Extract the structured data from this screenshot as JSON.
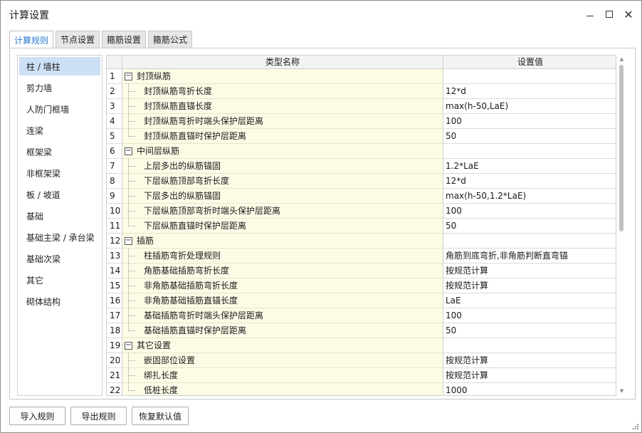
{
  "window": {
    "title": "计算设置",
    "minimize_icon": "minimize-icon",
    "maximize_icon": "maximize-icon",
    "close_icon": "close-icon",
    "close_glyph": "✕"
  },
  "tabs": [
    {
      "label": "计算规则",
      "active": true
    },
    {
      "label": "节点设置",
      "active": false
    },
    {
      "label": "箍筋设置",
      "active": false
    },
    {
      "label": "箍筋公式",
      "active": false
    }
  ],
  "sidebar": {
    "items": [
      {
        "label": "柱 / 墙柱",
        "selected": true
      },
      {
        "label": "剪力墙"
      },
      {
        "label": "人防门框墙"
      },
      {
        "label": "连梁"
      },
      {
        "label": "框架梁"
      },
      {
        "label": "非框架梁"
      },
      {
        "label": "板 / 坡道"
      },
      {
        "label": "基础"
      },
      {
        "label": "基础主梁 / 承台梁"
      },
      {
        "label": "基础次梁"
      },
      {
        "label": "其它"
      },
      {
        "label": "砌体结构"
      }
    ]
  },
  "grid": {
    "columns": {
      "name": "类型名称",
      "value": "设置值"
    },
    "rows": [
      {
        "num": "1",
        "name": "封顶纵筋",
        "value": "",
        "group": true,
        "toggle": "−"
      },
      {
        "num": "2",
        "name": "封顶纵筋弯折长度",
        "value": "12*d"
      },
      {
        "num": "3",
        "name": "封顶纵筋直锚长度",
        "value": "max(h-50,LaE)"
      },
      {
        "num": "4",
        "name": "封顶纵筋弯折时端头保护层距离",
        "value": "100"
      },
      {
        "num": "5",
        "name": "封顶纵筋直锚时保护层距离",
        "value": "50"
      },
      {
        "num": "6",
        "name": "中间层纵筋",
        "value": "",
        "group": true,
        "toggle": "−"
      },
      {
        "num": "7",
        "name": "上层多出的纵筋锚固",
        "value": "1.2*LaE"
      },
      {
        "num": "8",
        "name": "下层纵筋顶部弯折长度",
        "value": "12*d"
      },
      {
        "num": "9",
        "name": "下层多出的纵筋锚固",
        "value": "max(h-50,1.2*LaE)"
      },
      {
        "num": "10",
        "name": "下层纵筋顶部弯折时端头保护层距离",
        "value": "100"
      },
      {
        "num": "11",
        "name": "下层纵筋直锚时保护层距离",
        "value": "50"
      },
      {
        "num": "12",
        "name": "插筋",
        "value": "",
        "group": true,
        "toggle": "−"
      },
      {
        "num": "13",
        "name": "柱插筋弯折处理规则",
        "value": "角筋到底弯折,非角筋判断直弯锚"
      },
      {
        "num": "14",
        "name": "角筋基础插筋弯折长度",
        "value": "按规范计算"
      },
      {
        "num": "15",
        "name": "非角筋基础插筋弯折长度",
        "value": "按规范计算"
      },
      {
        "num": "16",
        "name": "非角筋基础插筋直锚长度",
        "value": "LaE"
      },
      {
        "num": "17",
        "name": "基础插筋弯折时端头保护层距离",
        "value": "100"
      },
      {
        "num": "18",
        "name": "基础插筋直锚时保护层距离",
        "value": "50"
      },
      {
        "num": "19",
        "name": "其它设置",
        "value": "",
        "group": true,
        "toggle": "−"
      },
      {
        "num": "20",
        "name": "嵌固部位设置",
        "value": "按规范计算"
      },
      {
        "num": "21",
        "name": "绑扎长度",
        "value": "按规范计算"
      },
      {
        "num": "22",
        "name": "低桩长度",
        "value": "1000"
      }
    ]
  },
  "footer": {
    "import_label": "导入规则",
    "export_label": "导出规则",
    "restore_label": "恢复默认值"
  },
  "colors": {
    "accent": "#2a7ad1",
    "selected_bg": "#cde0f5",
    "name_cell_bg": "#fdfbe6"
  }
}
